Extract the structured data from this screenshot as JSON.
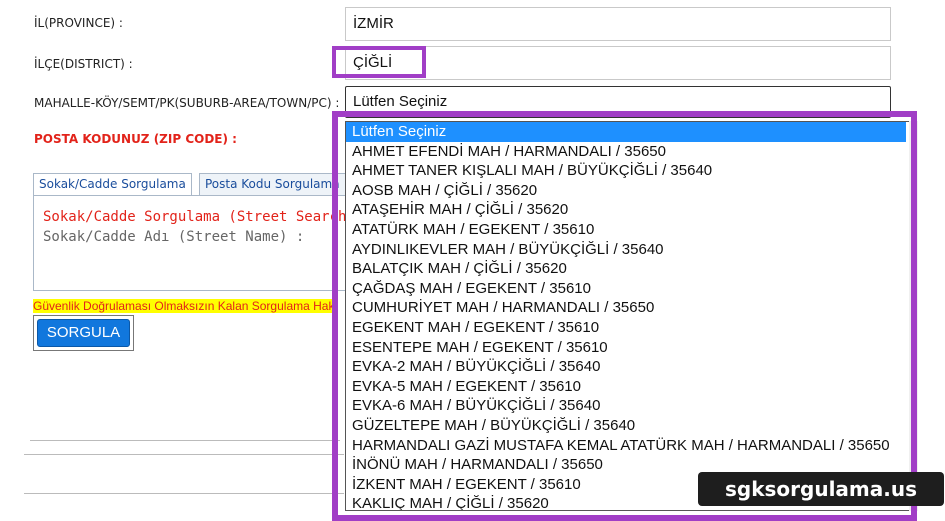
{
  "form": {
    "province_label": "İL(PROVINCE) :",
    "province_value": "İZMİR",
    "district_label": "İLÇE(DISTRICT) :",
    "district_value": "ÇİĞLİ",
    "neighborhood_label": "MAHALLE-KÖY/SEMT/PK(SUBURB-AREA/TOWN/PC) :",
    "neighborhood_value": "Lütfen Seçiniz",
    "zip_label": "POSTA KODUNUZ (ZIP CODE) :"
  },
  "tabs": [
    {
      "label": "Sokak/Cadde Sorgulama",
      "active": true
    },
    {
      "label": "Posta Kodu Sorgulama",
      "active": false
    }
  ],
  "panel": {
    "title": "Sokak/Cadde Sorgulama (Street Search)",
    "subtitle": "Sokak/Cadde Adı (Street Name) :"
  },
  "warning": "Güvenlik Doğrulaması Olmaksızın Kalan Sorgulama Hakkınız",
  "button_label": "SORGULA",
  "dropdown": {
    "selected_index": 0,
    "options": [
      "Lütfen Seçiniz",
      "AHMET EFENDİ MAH / HARMANDALI / 35650",
      "AHMET TANER KIŞLALI MAH / BÜYÜKÇİĞLİ / 35640",
      "AOSB MAH / ÇİĞLİ / 35620",
      "ATAŞEHİR MAH / ÇİĞLİ / 35620",
      "ATATÜRK MAH / EGEKENT / 35610",
      "AYDINLIKEVLER MAH / BÜYÜKÇİĞLİ / 35640",
      "BALATÇIK MAH / ÇİĞLİ / 35620",
      "ÇAĞDAŞ MAH / EGEKENT / 35610",
      "CUMHURİYET MAH / HARMANDALI / 35650",
      "EGEKENT MAH / EGEKENT / 35610",
      "ESENTEPE MAH / EGEKENT / 35610",
      "EVKA-2 MAH / BÜYÜKÇİĞLİ / 35640",
      "EVKA-5 MAH / EGEKENT / 35610",
      "EVKA-6 MAH / BÜYÜKÇİĞLİ / 35640",
      "GÜZELTEPE MAH / BÜYÜKÇİĞLİ / 35640",
      "HARMANDALI GAZİ MUSTAFA KEMAL ATATÜRK MAH / HARMANDALI / 35650",
      "İNÖNÜ MAH / HARMANDALI / 35650",
      "İZKENT MAH / EGEKENT / 35610",
      "KAKLIÇ MAH / ÇİĞLİ / 35620"
    ]
  },
  "watermark": "sgksorgulama.us",
  "colors": {
    "highlight": "#a13ec6",
    "selected_option": "#1e90ff",
    "error_text": "#e2231a",
    "button": "#1177dd"
  }
}
